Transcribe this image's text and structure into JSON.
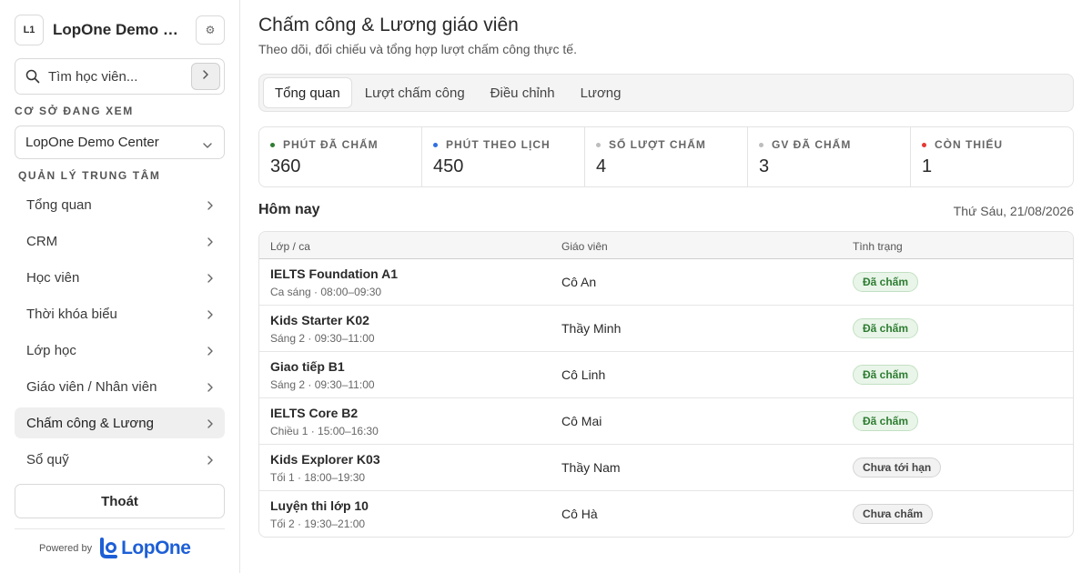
{
  "sidebar": {
    "badge": "L1",
    "brand_name": "LopOne Demo Center",
    "search_placeholder": "Tìm học viên...",
    "center_section_label": "CƠ SỞ ĐANG XEM",
    "center_selected": "LopOne Demo Center",
    "manage_section_label": "QUẢN LÝ TRUNG TÂM",
    "items": [
      {
        "label": "Tổng quan"
      },
      {
        "label": "CRM"
      },
      {
        "label": "Học viên"
      },
      {
        "label": "Thời khóa biểu"
      },
      {
        "label": "Lớp học"
      },
      {
        "label": "Giáo viên / Nhân viên"
      },
      {
        "label": "Chấm công & Lương"
      },
      {
        "label": "Sổ quỹ"
      }
    ],
    "active_item": "Chấm công & Lương",
    "logout_label": "Thoát",
    "powered_by": "Powered by",
    "logo_text": "LopOne"
  },
  "header": {
    "title": "Chấm công & Lương giáo viên",
    "subtitle": "Theo dõi, đối chiếu và tổng hợp lượt chấm công thực tế."
  },
  "tabs": [
    {
      "label": "Tổng quan"
    },
    {
      "label": "Lượt chấm công"
    },
    {
      "label": "Điều chỉnh"
    },
    {
      "label": "Lương"
    }
  ],
  "active_tab": "Tổng quan",
  "stats": [
    {
      "label": "PHÚT ĐÃ CHẤM",
      "value": "360",
      "dot_color": "#2e7d32"
    },
    {
      "label": "PHÚT THEO LỊCH",
      "value": "450",
      "dot_color": "#2f6fe0"
    },
    {
      "label": "SỐ LƯỢT CHẤM",
      "value": "4",
      "dot_color": "#bdbdbd"
    },
    {
      "label": "GV ĐÃ CHẤM",
      "value": "3",
      "dot_color": "#bdbdbd"
    },
    {
      "label": "CÒN THIẾU",
      "value": "1",
      "dot_color": "#e53935"
    }
  ],
  "today": {
    "title": "Hôm nay",
    "date": "Thứ Sáu, 21/08/2026"
  },
  "table": {
    "columns": [
      "Lớp / ca",
      "Giáo viên",
      "Tình trạng"
    ],
    "rows": [
      {
        "class": "IELTS Foundation A1",
        "time": "Ca sáng · 08:00–09:30",
        "teacher": "Cô An",
        "status": "Đã chấm",
        "status_type": "ok"
      },
      {
        "class": "Kids Starter K02",
        "time": "Sáng 2 · 09:30–11:00",
        "teacher": "Thầy Minh",
        "status": "Đã chấm",
        "status_type": "ok"
      },
      {
        "class": "Giao tiếp B1",
        "time": "Sáng 2 · 09:30–11:00",
        "teacher": "Cô Linh",
        "status": "Đã chấm",
        "status_type": "ok"
      },
      {
        "class": "IELTS Core B2",
        "time": "Chiều 1 · 15:00–16:30",
        "teacher": "Cô Mai",
        "status": "Đã chấm",
        "status_type": "ok"
      },
      {
        "class": "Kids Explorer K03",
        "time": "Tối 1 · 18:00–19:30",
        "teacher": "Thầy Nam",
        "status": "Chưa tới hạn",
        "status_type": "wait"
      },
      {
        "class": "Luyện thi lớp 10",
        "time": "Tối 2 · 19:30–21:00",
        "teacher": "Cô Hà",
        "status": "Chưa chấm",
        "status_type": "wait"
      }
    ]
  },
  "icons": {
    "settings": "gear-icon",
    "search": "search-icon",
    "search_go": "chevron-right-icon",
    "select": "chevron-down-icon",
    "nav": "chevron-right-icon",
    "logo": "lopone-logo-icon"
  }
}
